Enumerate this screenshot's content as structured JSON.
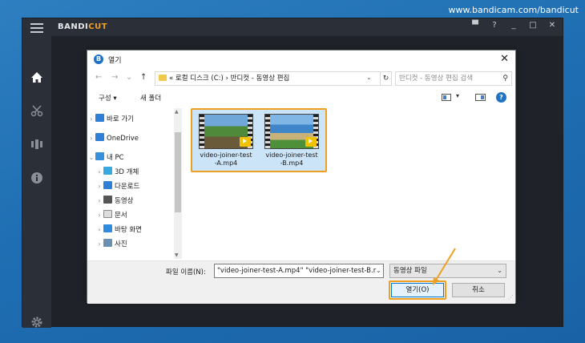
{
  "watermark": "www.bandicam.com/bandicut",
  "app": {
    "brand_main": "BANDI",
    "brand_accent": "CUT",
    "window_controls": [
      "folder-icon",
      "help-icon",
      "minimize-icon",
      "maximize-icon",
      "close-icon"
    ],
    "window_control_glyphs": [
      "▀",
      "?",
      "_",
      "□",
      "✕"
    ],
    "sidebar_icons": [
      "home-icon",
      "cut-icon",
      "join-icon",
      "info-icon",
      "settings-icon"
    ]
  },
  "dialog": {
    "title": "열기",
    "title_icon_glyph": "B",
    "close_glyph": "✕",
    "nav": {
      "back": "←",
      "forward": "→",
      "recent": "⌄",
      "up": "↑"
    },
    "address": {
      "prefix": "«",
      "segments": "로컬 디스크 (C:)  ›  반디컷 - 동영상 편집"
    },
    "refresh_glyph": "↻",
    "search_placeholder": "반디컷 - 동영상 편집 검색",
    "toolbar": {
      "organize": "구성 ▾",
      "new_folder": "새 폴더"
    },
    "nav_pane": [
      {
        "label": "바로 가기",
        "icon": "star-icon",
        "color": "#2f7fd6",
        "indent": 0,
        "chev": "›"
      },
      {
        "label": "OneDrive",
        "icon": "cloud-icon",
        "color": "#2f7fd6",
        "indent": 0,
        "chev": "›"
      },
      {
        "label": "내 PC",
        "icon": "computer-icon",
        "color": "#3a8fd9",
        "indent": 0,
        "chev": "⌄"
      },
      {
        "label": "3D 개체",
        "icon": "cube-icon",
        "color": "#37a8e0",
        "indent": 1,
        "chev": "›"
      },
      {
        "label": "다운로드",
        "icon": "download-icon",
        "color": "#2f7fd6",
        "indent": 1,
        "chev": "›"
      },
      {
        "label": "동영상",
        "icon": "video-icon",
        "color": "#555555",
        "indent": 1,
        "chev": "›"
      },
      {
        "label": "문서",
        "icon": "document-icon",
        "color": "#dddddd",
        "indent": 1,
        "chev": "›"
      },
      {
        "label": "바탕 화면",
        "icon": "desktop-icon",
        "color": "#2f8be0",
        "indent": 1,
        "chev": "›"
      },
      {
        "label": "사진",
        "icon": "picture-icon",
        "color": "#6a8fb0",
        "indent": 1,
        "chev": "›"
      }
    ],
    "files": [
      {
        "name": "video-joiner-test-A.mp4",
        "name_line1": "video-joiner-test",
        "name_line2": "-A.mp4",
        "badge": "Player"
      },
      {
        "name": "video-joiner-test-B.mp4",
        "name_line1": "video-joiner-test",
        "name_line2": "-B.mp4",
        "badge": "Player"
      }
    ],
    "filename_label": "파일 이름(N):",
    "filename_value": "\"video-joiner-test-A.mp4\" \"video-joiner-test-B.r",
    "filetype": "동영상 파일",
    "open_button": "열기(O)",
    "cancel_button": "취소"
  },
  "colors": {
    "accent_highlight": "#f0a020",
    "selection_fill": "#cce4f7",
    "background_blue": "#2a79bd"
  }
}
